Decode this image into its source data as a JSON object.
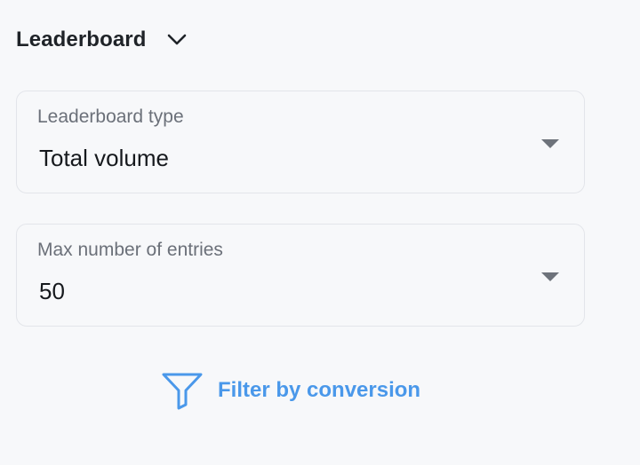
{
  "header": {
    "title": "Leaderboard",
    "toggle_icon": "chevron-down-icon"
  },
  "leaderboard_type": {
    "label": "Leaderboard type",
    "value": "Total volume",
    "arrow_icon": "caret-down-icon"
  },
  "max_entries": {
    "label": "Max number of entries",
    "value": "50",
    "arrow_icon": "caret-down-icon"
  },
  "filter": {
    "label": "Filter by conversion",
    "icon": "filter-funnel-icon",
    "color": "#4a98ea"
  },
  "colors": {
    "background": "#f7f8fa",
    "border": "#e3e5ea",
    "label": "#6b7079",
    "text": "#16191d",
    "accent": "#4a98ea"
  }
}
